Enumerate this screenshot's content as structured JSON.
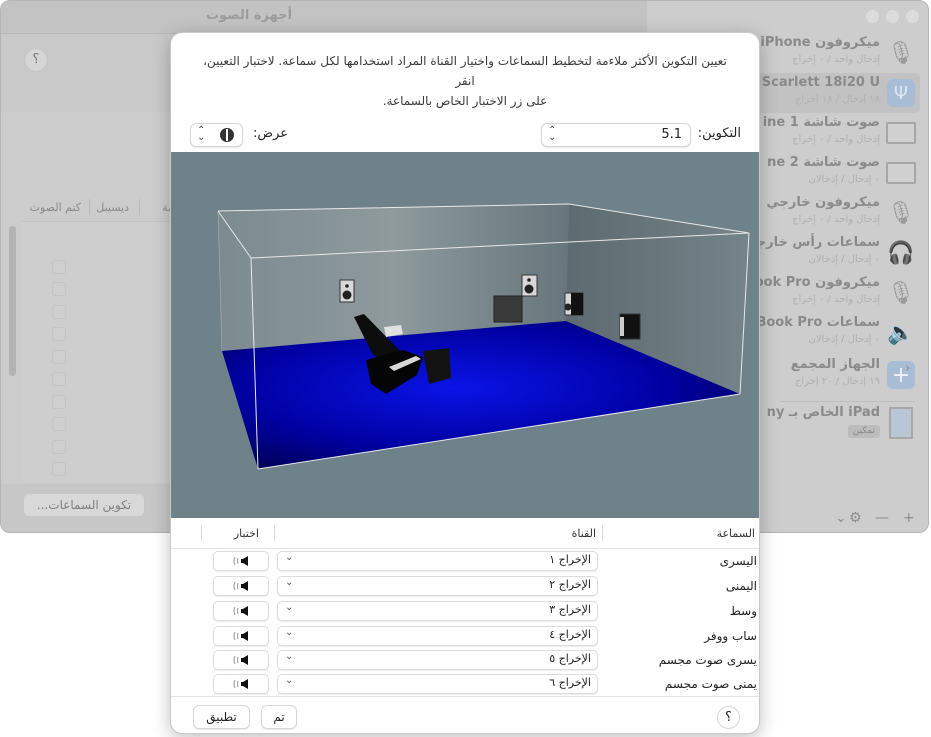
{
  "main_window": {
    "title": "أجهزة الصوت",
    "help_label": "؟",
    "table_headers": [
      "كتم الصوت",
      "ديسيبل",
      "قيمة"
    ],
    "configure_speakers_label": "تكوين السماعات..."
  },
  "sidebar": {
    "devices": [
      {
        "name": "ميكروفون iPhone",
        "sub": "إدخال واحد / ٠ إخراج",
        "icon": "iphone-microphone-icon"
      },
      {
        "name": "Scarlett 18i20 U",
        "sub": "١٨ إدخال / ١٨ إخراج",
        "icon": "usb-icon",
        "selected": true
      },
      {
        "name": "صوت شاشة 1 ine",
        "sub": "إدخال واحد / ٠ إخراج",
        "icon": "monitor-icon"
      },
      {
        "name": "صوت شاشة 2 ne",
        "sub": "٠ إدخال / إدخالان",
        "icon": "monitor-icon"
      },
      {
        "name": "ميكروفون خارجي",
        "sub": "إدخال واحد / ٠ إخراج",
        "icon": "microphone-icon"
      },
      {
        "name": "سماعات رأس خارجية",
        "sub": "٠ إدخال / إدخالان",
        "icon": "headphones-icon"
      },
      {
        "name": "ميكروفون MacBook Pro",
        "sub": "إدخال واحد / ٠ إخراج",
        "icon": "microphone-icon"
      },
      {
        "name": "سماعات MacBook Pro",
        "sub": "٠ إدخال / إدخالان",
        "icon": "speaker-icon"
      },
      {
        "name": "الجهاز المجمع",
        "sub": "١٩ إدخال / ٢٠ إخراج",
        "icon": "aggregate-plus-icon"
      },
      {
        "name": "iPad الخاص بـ ny",
        "badge": "تمكين",
        "icon": "ipad-icon"
      }
    ],
    "footer": {
      "add": "+",
      "remove": "—",
      "gear": "⚙",
      "chevron": "⌄"
    }
  },
  "sheet": {
    "intro_line1": "تعيين التكوين الأكثر ملاءمة لتخطيط السماعات واختيار القناة المراد استخدامها لكل سماعة. لاختبار التعيين، انقر",
    "intro_line2": "على زر الاختبار الخاص بالسماعة.",
    "config_label": "التكوين:",
    "config_value": "5.1",
    "view_label": "عرض:",
    "table": {
      "headers": {
        "speaker": "السماعة",
        "channel": "القناة",
        "test": "اختبار"
      },
      "rows": [
        {
          "speaker": "اليسرى",
          "channel": "الإخراج ١"
        },
        {
          "speaker": "اليمنى",
          "channel": "الإخراج ٢"
        },
        {
          "speaker": "وسط",
          "channel": "الإخراج ٣"
        },
        {
          "speaker": "ساب ووفر",
          "channel": "الإخراج ٤"
        },
        {
          "speaker": "يسرى صوت مجسم",
          "channel": "الإخراج ٥"
        },
        {
          "speaker": "يمنى صوت مجسم",
          "channel": "الإخراج ٦"
        }
      ]
    },
    "buttons": {
      "apply": "تطبيق",
      "done": "تم",
      "help": "؟"
    },
    "colors": {
      "scene_bg": "#6e8088",
      "floor": "#0000b8"
    }
  }
}
